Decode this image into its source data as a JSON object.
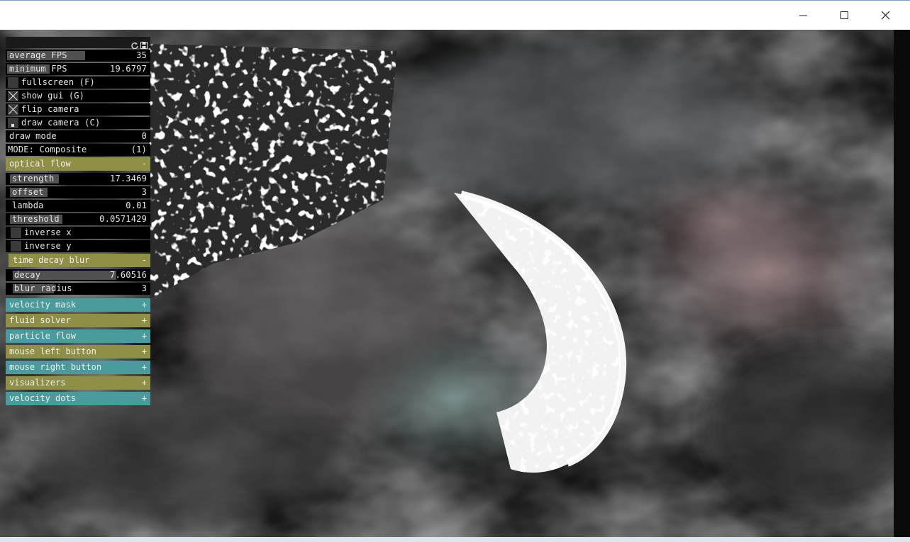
{
  "window": {
    "controls": {
      "minimize": "minimize-icon",
      "maximize": "maximize-icon",
      "close": "close-icon"
    }
  },
  "gui": {
    "header_icons": [
      "refresh-icon",
      "save-icon"
    ],
    "average_fps": {
      "label": "average FPS",
      "value": "35",
      "level": 0.55
    },
    "minimum_fps": {
      "label": "minimum FPS",
      "value": "19.6797",
      "level": 0.3
    },
    "fullscreen": {
      "label": "fullscreen (F)",
      "checked": false
    },
    "show_gui": {
      "label": "show gui (G)",
      "checked": true
    },
    "flip_camera": {
      "label": "flip camera",
      "checked": true
    },
    "draw_camera": {
      "label": "draw camera (C)",
      "checked": true
    },
    "draw_mode": {
      "label": "draw mode",
      "value": "0"
    },
    "mode": {
      "label": "MODE: Composite",
      "value": "(1)"
    },
    "optical_flow": {
      "title": "optical flow",
      "toggle": "-",
      "strength": {
        "label": "strength",
        "value": "17.3469",
        "level": 0.35
      },
      "offset": {
        "label": "offset",
        "value": "3",
        "level": 0.27
      },
      "lambda": {
        "label": "lambda",
        "value": "0.01",
        "level": 0.0
      },
      "threshold": {
        "label": "threshold",
        "value": "0.0571429",
        "level": 0.38
      },
      "inverse_x": {
        "label": "inverse x",
        "checked": false
      },
      "inverse_y": {
        "label": "inverse y",
        "checked": false
      },
      "time_decay_blur": {
        "title": "time decay blur",
        "toggle": "-",
        "decay": {
          "label": "decay",
          "value": "7.60516",
          "level": 0.76
        },
        "blur_radius": {
          "label": "blur radius",
          "value": "3",
          "level": 0.3
        }
      }
    },
    "groups": [
      {
        "title": "velocity mask",
        "toggle": "+",
        "color": "#4a9b9b"
      },
      {
        "title": "fluid solver",
        "toggle": "+",
        "color": "#8f8f46"
      },
      {
        "title": "particle flow",
        "toggle": "+",
        "color": "#4a9b9b"
      },
      {
        "title": "mouse left button",
        "toggle": "+",
        "color": "#8f8f46"
      },
      {
        "title": "mouse right button",
        "toggle": "+",
        "color": "#4a9b9b"
      },
      {
        "title": "visualizers",
        "toggle": "+",
        "color": "#8f8f46"
      },
      {
        "title": "velocity dots",
        "toggle": "+",
        "color": "#4a9b9b"
      }
    ]
  },
  "colors": {
    "olive": "#8f8f46",
    "teal": "#4a9b9b",
    "panel": "#000000",
    "slider": "#505050"
  }
}
